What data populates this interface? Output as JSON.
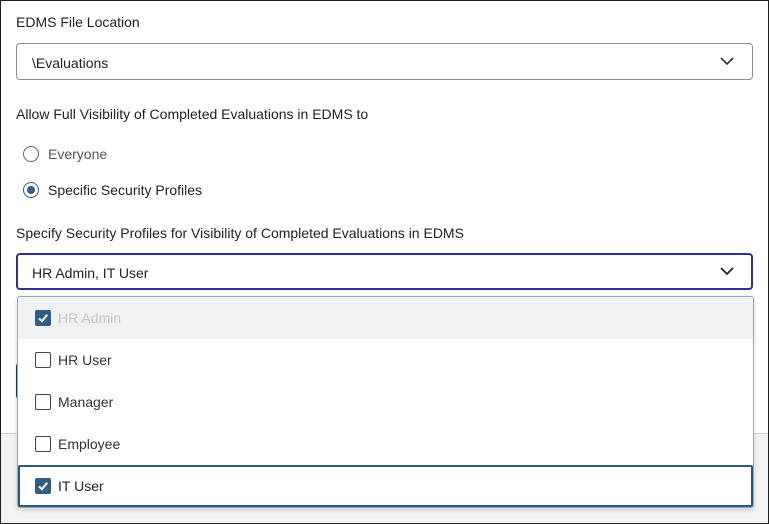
{
  "edms_location": {
    "label": "EDMS File Location",
    "value": "\\Evaluations",
    "chevron_icon": "chevron-down-icon"
  },
  "visibility": {
    "label": "Allow Full Visibility of Completed Evaluations in EDMS to",
    "options": [
      {
        "label": "Everyone",
        "selected": false
      },
      {
        "label": "Specific Security Profiles",
        "selected": true
      }
    ]
  },
  "profiles": {
    "label": "Specify Security Profiles for Visibility of Completed Evaluations in EDMS",
    "value": "HR Admin, IT User",
    "chevron_icon": "chevron-down-icon",
    "focus_color": "#2e3192",
    "options": [
      {
        "label": "HR Admin",
        "checked": true,
        "state": "highlighted"
      },
      {
        "label": "HR User",
        "checked": false,
        "state": "normal"
      },
      {
        "label": "Manager",
        "checked": false,
        "state": "normal"
      },
      {
        "label": "Employee",
        "checked": false,
        "state": "normal"
      },
      {
        "label": "IT User",
        "checked": true,
        "state": "focused"
      }
    ]
  },
  "colors": {
    "accent": "#2f5d84",
    "border": "#8c8c8c"
  }
}
